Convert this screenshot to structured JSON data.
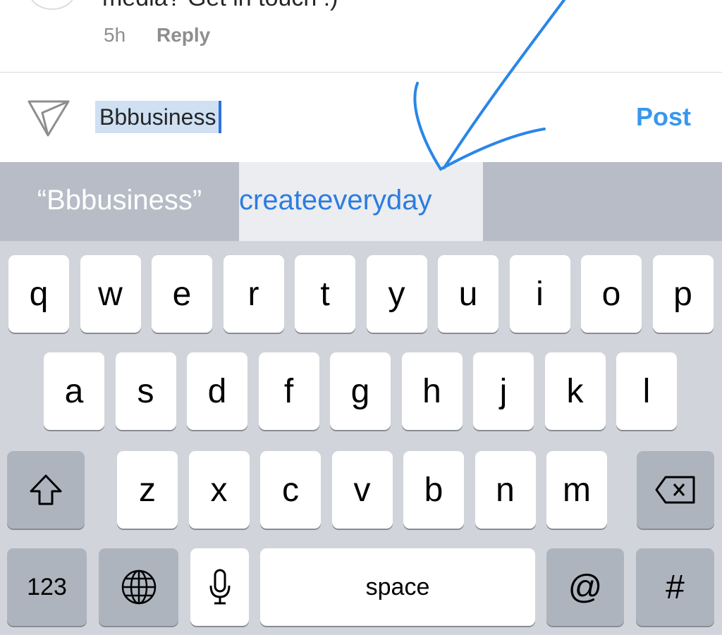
{
  "comment": {
    "text": "media? Get in touch :)",
    "time": "5h",
    "reply_label": "Reply"
  },
  "composer": {
    "value": "Bbbusiness",
    "post_label": "Post",
    "send_icon": "paper-plane-icon"
  },
  "suggestions": [
    "“Bbbusiness”",
    "createeveryday"
  ],
  "keyboard": {
    "row1": [
      "q",
      "w",
      "e",
      "r",
      "t",
      "y",
      "u",
      "i",
      "o",
      "p"
    ],
    "row2": [
      "a",
      "s",
      "d",
      "f",
      "g",
      "h",
      "j",
      "k",
      "l"
    ],
    "row3": [
      "z",
      "x",
      "c",
      "v",
      "b",
      "n",
      "m"
    ],
    "numbers_label": "123",
    "space_label": "space",
    "at_label": "@",
    "hash_label": "#"
  },
  "colors": {
    "accent": "#3897f0",
    "annotation": "#2a86e8"
  }
}
